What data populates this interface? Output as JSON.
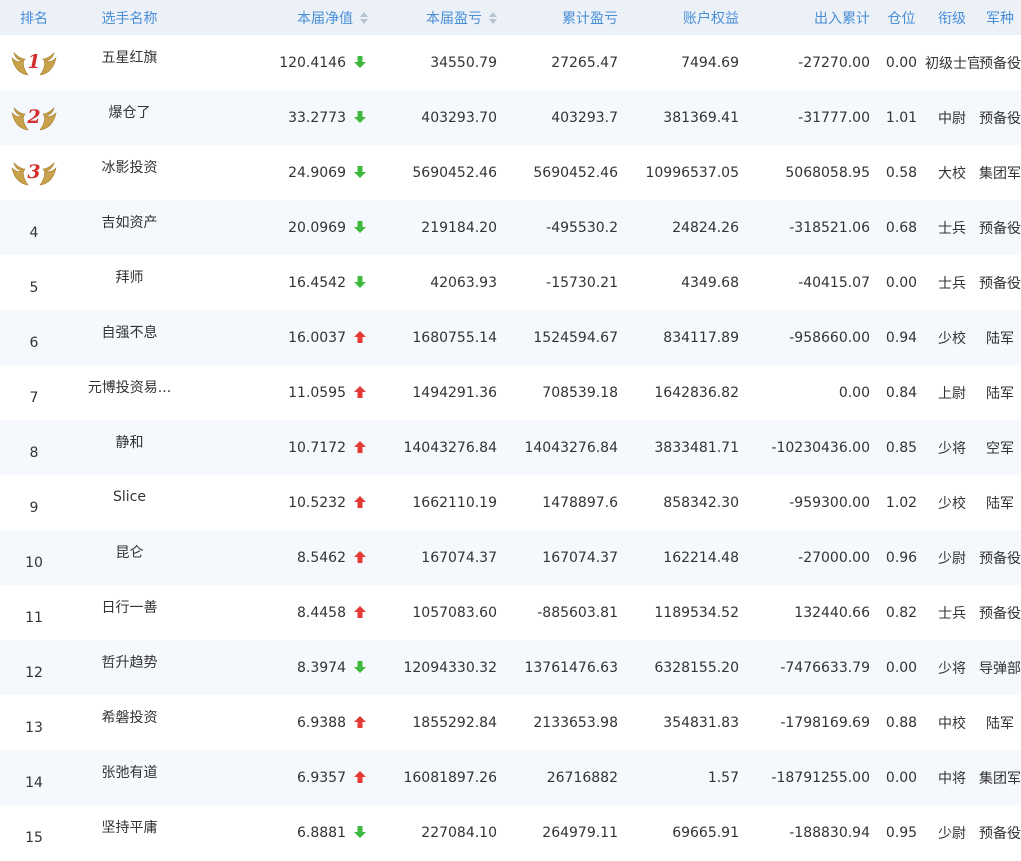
{
  "columns": {
    "rank": "排名",
    "player": "选手名称",
    "nav": "本届净值",
    "profit": "本届盈亏",
    "cum_profit": "累计盈亏",
    "equity": "账户权益",
    "in_out": "出入累计",
    "position": "仓位",
    "title": "衔级",
    "branch": "军种"
  },
  "colors": {
    "up": "#e53935",
    "down": "#3fb83f",
    "header_text": "#4a8fd6",
    "medal": "#c9a14a",
    "medal_number": "#d32f2f"
  },
  "rows": [
    {
      "rank": "1",
      "medal": true,
      "name": "五星红旗",
      "nav": "120.4146",
      "trend": "down",
      "profit": "34550.79",
      "cum_profit": "27265.47",
      "equity": "7494.69",
      "in_out": "-27270.00",
      "position": "0.00",
      "title": "初级士官",
      "branch": "预备役"
    },
    {
      "rank": "2",
      "medal": true,
      "name": "爆仓了",
      "nav": "33.2773",
      "trend": "down",
      "profit": "403293.70",
      "cum_profit": "403293.7",
      "equity": "381369.41",
      "in_out": "-31777.00",
      "position": "1.01",
      "title": "中尉",
      "branch": "预备役"
    },
    {
      "rank": "3",
      "medal": true,
      "name": "冰影投资",
      "nav": "24.9069",
      "trend": "down",
      "profit": "5690452.46",
      "cum_profit": "5690452.46",
      "equity": "10996537.05",
      "in_out": "5068058.95",
      "position": "0.58",
      "title": "大校",
      "branch": "集团军"
    },
    {
      "rank": "4",
      "medal": false,
      "name": "吉如资产",
      "nav": "20.0969",
      "trend": "down",
      "profit": "219184.20",
      "cum_profit": "-495530.2",
      "equity": "24824.26",
      "in_out": "-318521.06",
      "position": "0.68",
      "title": "士兵",
      "branch": "预备役"
    },
    {
      "rank": "5",
      "medal": false,
      "name": "拜师",
      "nav": "16.4542",
      "trend": "down",
      "profit": "42063.93",
      "cum_profit": "-15730.21",
      "equity": "4349.68",
      "in_out": "-40415.07",
      "position": "0.00",
      "title": "士兵",
      "branch": "预备役"
    },
    {
      "rank": "6",
      "medal": false,
      "name": "自强不息",
      "nav": "16.0037",
      "trend": "up",
      "profit": "1680755.14",
      "cum_profit": "1524594.67",
      "equity": "834117.89",
      "in_out": "-958660.00",
      "position": "0.94",
      "title": "少校",
      "branch": "陆军"
    },
    {
      "rank": "7",
      "medal": false,
      "name": "元博投资易...",
      "nav": "11.0595",
      "trend": "up",
      "profit": "1494291.36",
      "cum_profit": "708539.18",
      "equity": "1642836.82",
      "in_out": "0.00",
      "position": "0.84",
      "title": "上尉",
      "branch": "陆军"
    },
    {
      "rank": "8",
      "medal": false,
      "name": "静和",
      "nav": "10.7172",
      "trend": "up",
      "profit": "14043276.84",
      "cum_profit": "14043276.84",
      "equity": "3833481.71",
      "in_out": "-10230436.00",
      "position": "0.85",
      "title": "少将",
      "branch": "空军"
    },
    {
      "rank": "9",
      "medal": false,
      "name": "Slice",
      "nav": "10.5232",
      "trend": "up",
      "profit": "1662110.19",
      "cum_profit": "1478897.6",
      "equity": "858342.30",
      "in_out": "-959300.00",
      "position": "1.02",
      "title": "少校",
      "branch": "陆军"
    },
    {
      "rank": "10",
      "medal": false,
      "name": "昆仑",
      "nav": "8.5462",
      "trend": "up",
      "profit": "167074.37",
      "cum_profit": "167074.37",
      "equity": "162214.48",
      "in_out": "-27000.00",
      "position": "0.96",
      "title": "少尉",
      "branch": "预备役"
    },
    {
      "rank": "11",
      "medal": false,
      "name": "日行一善",
      "nav": "8.4458",
      "trend": "up",
      "profit": "1057083.60",
      "cum_profit": "-885603.81",
      "equity": "1189534.52",
      "in_out": "132440.66",
      "position": "0.82",
      "title": "士兵",
      "branch": "预备役"
    },
    {
      "rank": "12",
      "medal": false,
      "name": "哲升趋势",
      "nav": "8.3974",
      "trend": "down",
      "profit": "12094330.32",
      "cum_profit": "13761476.63",
      "equity": "6328155.20",
      "in_out": "-7476633.79",
      "position": "0.00",
      "title": "少将",
      "branch": "导弹部队"
    },
    {
      "rank": "13",
      "medal": false,
      "name": "希磐投资",
      "nav": "6.9388",
      "trend": "up",
      "profit": "1855292.84",
      "cum_profit": "2133653.98",
      "equity": "354831.83",
      "in_out": "-1798169.69",
      "position": "0.88",
      "title": "中校",
      "branch": "陆军"
    },
    {
      "rank": "14",
      "medal": false,
      "name": "张弛有道",
      "nav": "6.9357",
      "trend": "up",
      "profit": "16081897.26",
      "cum_profit": "26716882",
      "equity": "1.57",
      "in_out": "-18791255.00",
      "position": "0.00",
      "title": "中将",
      "branch": "集团军"
    },
    {
      "rank": "15",
      "medal": false,
      "name": "坚持平庸",
      "nav": "6.8881",
      "trend": "down",
      "profit": "227084.10",
      "cum_profit": "264979.11",
      "equity": "69665.91",
      "in_out": "-188830.94",
      "position": "0.95",
      "title": "少尉",
      "branch": "预备役"
    }
  ]
}
